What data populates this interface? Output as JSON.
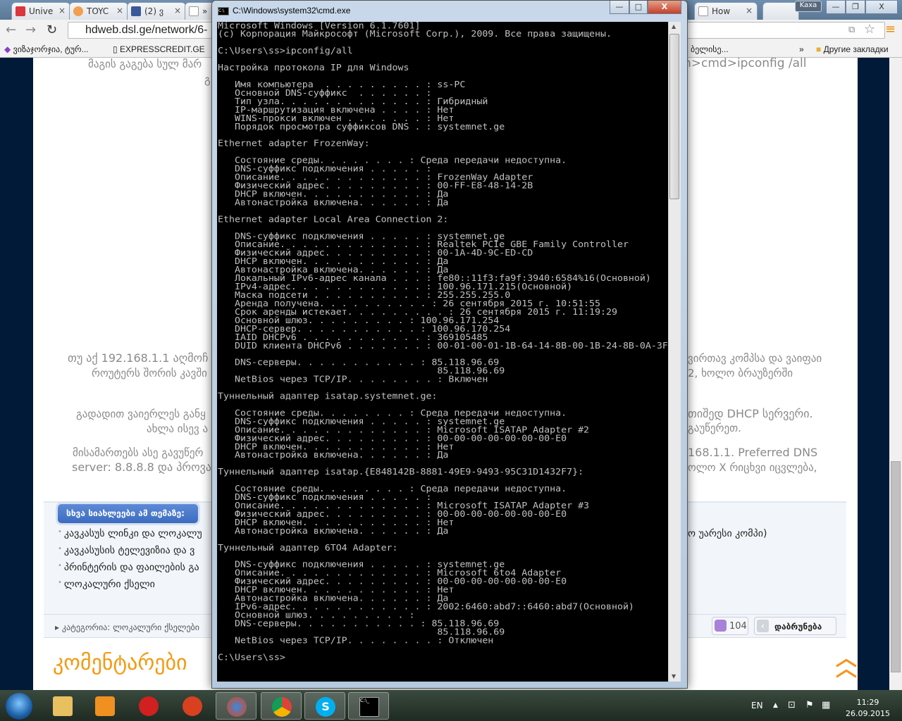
{
  "browser": {
    "tabs": [
      {
        "label": "Unive",
        "color": "#d9363e"
      },
      {
        "label": "TOYC",
        "color": "#f0a050"
      },
      {
        "label": "(2) ვ",
        "color": "#3b5998"
      },
      {
        "label": "»",
        "color": "#ffffff"
      },
      {
        "label": "How",
        "color": "#ffffff"
      }
    ],
    "url": "hdweb.dsl.ge/network/6-",
    "user_badge": "Kaxa",
    "bookmarks": [
      "ვიზაჯორჯია, ტურ...",
      "EXPRESSCREDIT.GE",
      "ბელისე...",
      "»",
      "Другие закладки"
    ]
  },
  "page": {
    "left_text": [
      "მაგის გაგება სულ მარ",
      "გ",
      "თუ აქ 192.168.1.1 აღმოჩ",
      "როუტერს შორის კავში",
      "გადადით ვაიერლეს განყ",
      "ახლა ისევ ა",
      "მისამართებს ასე გავუწერ",
      "server: 8.8.8.8 და პროვა"
    ],
    "right_text": [
      "n>cmd>ipconfig /all",
      "ვირთავ კომპსა და ვაიფაი",
      "2, ხოლო ბრაუზერში",
      "თიშედ DHCP სერვერი.",
      "გაუწერეთ.",
      "168.1.1. Preferred DNS",
      "ოლო X რიცხვი იცვლება,"
    ],
    "related_heading": "სხვა სიახლეები ამ თემაზე:",
    "related_items": [
      "კავკასუს ლინკი და ლოკალუ",
      "კავკასუსის ტელევიზია და ვ",
      "პრინტერის და ფაილების გა",
      "ლოკალური ქსელი"
    ],
    "related_item_tail": "ო უარესი კომპი)",
    "category": "▸ კატეგორია: ლოკალური ქსელები",
    "comment_count": "104",
    "back_label": "დაბრუნება",
    "comments_heading": "კომენტარები"
  },
  "cmd": {
    "title": "C:\\Windows\\system32\\cmd.exe",
    "lines": [
      "Microsoft Windows [Version 6.1.7601]",
      "(c) Корпорация Майкрософт (Microsoft Corp.), 2009. Все права защищены.",
      "",
      "C:\\Users\\ss>ipconfig/all",
      "",
      "Настройка протокола IP для Windows",
      "",
      "   Имя компьютера  . . . . . . . . . : ss-PC",
      "   Основной DNS-суффикс  . . . . . . :",
      "   Тип узла. . . . . . . . . . . . . : Гибридный",
      "   IP-маршрутизация включена . . . . : Нет",
      "   WINS-прокси включен . . . . . . . : Нет",
      "   Порядок просмотра суффиксов DNS . : systemnet.ge",
      "",
      "Ethernet adapter FrozenWay:",
      "",
      "   Состояние среды. . . . . . . . : Среда передачи недоступна.",
      "   DNS-суффикс подключения . . . . . :",
      "   Описание. . . . . . . . . . . . . : FrozenWay Adapter",
      "   Физический адрес. . . . . . . . . : 00-FF-E8-48-14-2B",
      "   DHCP включен. . . . . . . . . . . : Да",
      "   Автонастройка включена. . . . . . : Да",
      "",
      "Ethernet adapter Local Area Connection 2:",
      "",
      "   DNS-суффикс подключения . . . . . : systemnet.ge",
      "   Описание. . . . . . . . . . . . . : Realtek PCIe GBE Family Controller",
      "   Физический адрес. . . . . . . . . : 00-1A-4D-9C-ED-CD",
      "   DHCP включен. . . . . . . . . . . : Да",
      "   Автонастройка включена. . . . . . : Да",
      "   Локальный IPv6-адрес канала . . . : fe80::11f3:fa9f:3940:6584%16(Основной)",
      "   IPv4-адрес. . . . . . . . . . . . : 100.96.171.215(Основной)",
      "   Маска подсети . . . . . . . . . . : 255.255.255.0",
      "   Аренда получена. . . . . . . . . . : 26 сентября 2015 г. 10:51:55",
      "   Срок аренды истекает. . . . . . . . . : 26 сентября 2015 г. 11:19:29",
      "   Основной шлюз. . . . . . . . . : 100.96.171.254",
      "   DHCP-сервер. . . . . . . . . . . : 100.96.170.254",
      "   IAID DHCPv6 . . . . . . . . . . . : 369105485",
      "   DUID клиента DHCPv6 . . . . . . . : 00-01-00-01-1B-64-14-8B-00-1B-24-8B-0A-3F",
      "",
      "   DNS-серверы. . . . . . . . . . . : 85.118.96.69",
      "                                       85.118.96.69",
      "   NetBios через TCP/IP. . . . . . . . : Включен",
      "",
      "Туннельный адаптер isatap.systemnet.ge:",
      "",
      "   Состояние среды. . . . . . . . : Среда передачи недоступна.",
      "   DNS-суффикс подключения . . . . . : systemnet.ge",
      "   Описание. . . . . . . . . . . . . : Microsoft ISATAP Adapter #2",
      "   Физический адрес. . . . . . . . . : 00-00-00-00-00-00-00-E0",
      "   DHCP включен. . . . . . . . . . . : Нет",
      "   Автонастройка включена. . . . . . : Да",
      "",
      "Туннельный адаптер isatap.{E848142B-8881-49E9-9493-95C31D1432F7}:",
      "",
      "   Состояние среды. . . . . . . . : Среда передачи недоступна.",
      "   DNS-суффикс подключения . . . . . :",
      "   Описание. . . . . . . . . . . . . : Microsoft ISATAP Adapter #3",
      "   Физический адрес. . . . . . . . . : 00-00-00-00-00-00-00-E0",
      "   DHCP включен. . . . . . . . . . . : Нет",
      "   Автонастройка включена. . . . . . : Да",
      "",
      "Туннельный адаптер 6TO4 Adapter:",
      "",
      "   DNS-суффикс подключения . . . . . : systemnet.ge",
      "   Описание. . . . . . . . . . . . . : Microsoft 6to4 Adapter",
      "   Физический адрес. . . . . . . . . : 00-00-00-00-00-00-00-E0",
      "   DHCP включен. . . . . . . . . . . : Нет",
      "   Автонастройка включена. . . . . . : Да",
      "   IPv6-адрес. . . . . . . . . . . . : 2002:6460:abd7::6460:abd7(Основной)",
      "   Основной шлюз. . . . . . . . . :",
      "   DNS-серверы. . . . . . . . . . . : 85.118.96.69",
      "                                       85.118.96.69",
      "   NetBios через TCP/IP. . . . . . . . : Отключен",
      "",
      "C:\\Users\\ss>"
    ]
  },
  "taskbar": {
    "language": "EN",
    "time": "11:29",
    "date": "26.09.2015",
    "apps": [
      "explorer",
      "media-player",
      "app-red",
      "ccleaner",
      "browser-flame",
      "chrome",
      "skype",
      "cmd"
    ]
  }
}
